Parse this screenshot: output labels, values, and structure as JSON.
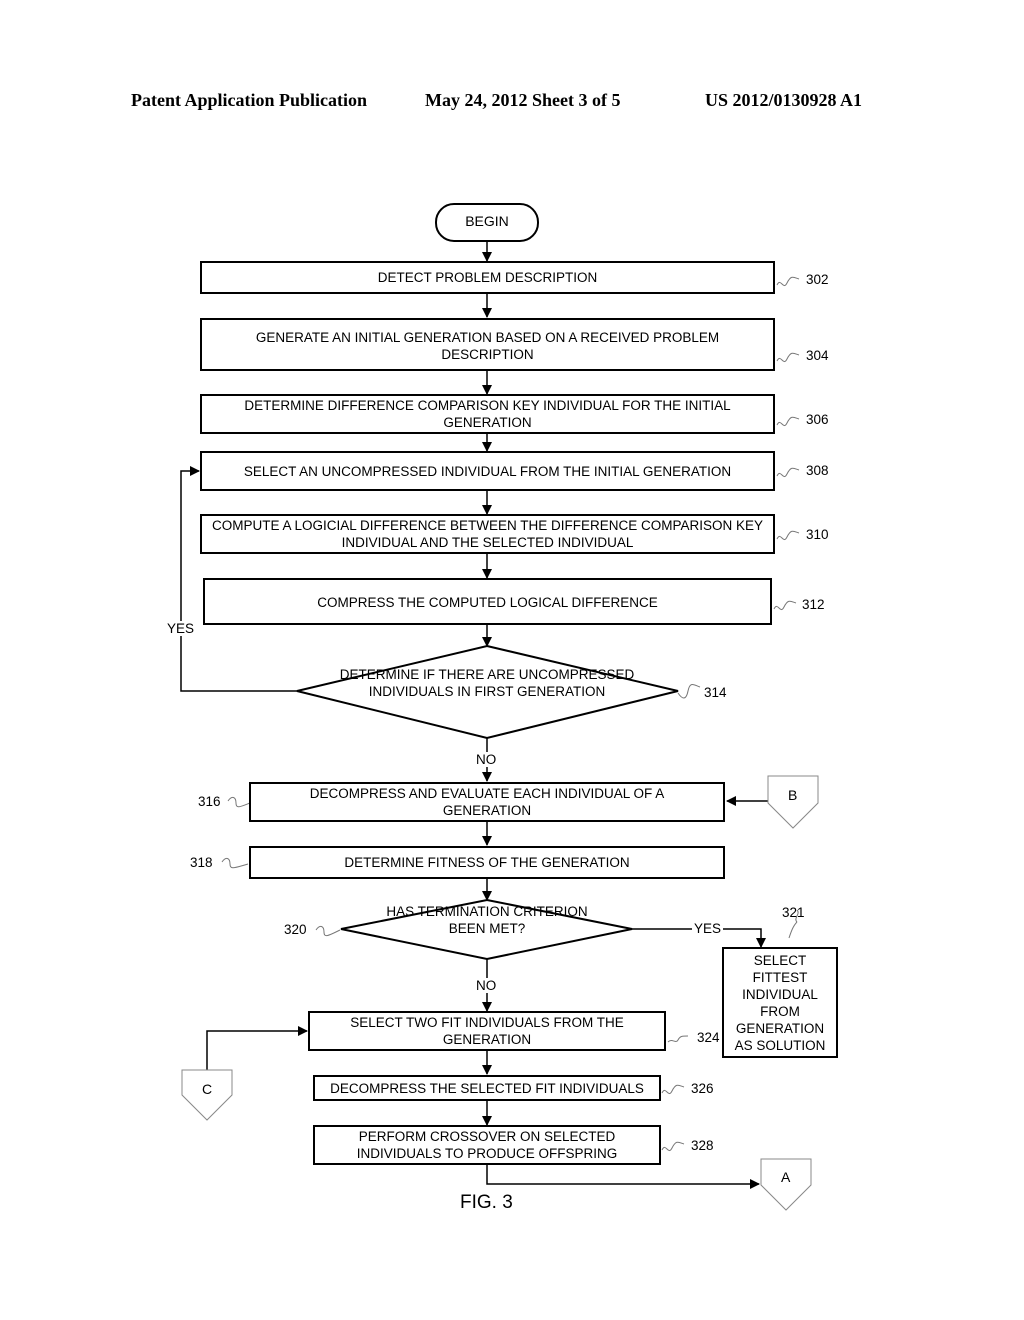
{
  "header": {
    "publication": "Patent Application Publication",
    "date_sheet": "May 24, 2012  Sheet 3 of 5",
    "number": "US 2012/0130928 A1"
  },
  "flowchart": {
    "begin": "BEGIN",
    "steps": [
      {
        "id": "302",
        "text": "DETECT PROBLEM DESCRIPTION"
      },
      {
        "id": "304",
        "text": "GENERATE AN INITIAL GENERATION BASED ON A RECEIVED PROBLEM DESCRIPTION"
      },
      {
        "id": "306",
        "text": "DETERMINE DIFFERENCE COMPARISON KEY INDIVIDUAL FOR THE INITIAL GENERATION"
      },
      {
        "id": "308",
        "text": "SELECT AN UNCOMPRESSED INDIVIDUAL FROM THE INITIAL GENERATION"
      },
      {
        "id": "310",
        "text": "COMPUTE A LOGICIAL DIFFERENCE BETWEEN THE DIFFERENCE COMPARISON KEY INDIVIDUAL AND THE SELECTED INDIVIDUAL"
      },
      {
        "id": "312",
        "text": "COMPRESS THE COMPUTED LOGICAL DIFFERENCE"
      },
      {
        "id": "316",
        "text": "DECOMPRESS AND EVALUATE EACH INDIVIDUAL OF A GENERATION"
      },
      {
        "id": "318",
        "text": "DETERMINE FITNESS OF THE GENERATION"
      },
      {
        "id": "321",
        "text": "SELECT FITTEST INDIVIDUAL FROM GENERATION AS SOLUTION"
      },
      {
        "id": "324",
        "text": "SELECT TWO FIT INDIVIDUALS FROM THE GENERATION"
      },
      {
        "id": "326",
        "text": "DECOMPRESS THE SELECTED FIT INDIVIDUALS"
      },
      {
        "id": "328",
        "text": "PERFORM CROSSOVER ON SELECTED INDIVIDUALS TO PRODUCE OFFSPRING"
      }
    ],
    "decisions": [
      {
        "id": "314",
        "text": "DETERMINE IF THERE ARE UNCOMPRESSED INDIVIDUALS IN FIRST GENERATION",
        "yes": "YES",
        "no": "NO"
      },
      {
        "id": "320",
        "text": "HAS TERMINATION CRITERION BEEN MET?",
        "yes": "YES",
        "no": "NO"
      }
    ],
    "connectors": {
      "a": "A",
      "b": "B",
      "c": "C"
    },
    "figure_label": "FIG. 3"
  }
}
